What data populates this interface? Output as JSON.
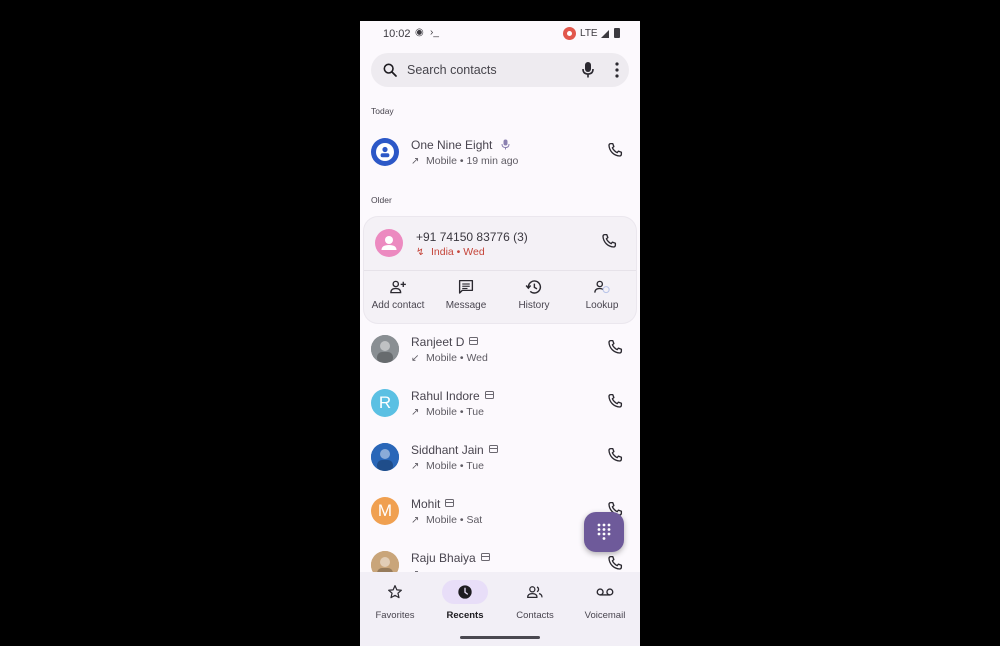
{
  "status_bar": {
    "time": "10:02",
    "network": "LTE"
  },
  "search": {
    "placeholder": "Search contacts",
    "value": ""
  },
  "sections": {
    "today": "Today",
    "older": "Older"
  },
  "calls_today": [
    {
      "name": "One Nine Eight",
      "direction": "outgoing",
      "direction_glyph": "↗",
      "detail": "Mobile • 19 min ago",
      "avatar_color": "#2c58c7",
      "avatar_type": "icon",
      "badge": "mic"
    }
  ],
  "expanded_call": {
    "name": "+91 74150 83776  (3)",
    "direction": "missed",
    "direction_glyph": "↯",
    "detail": "India • Wed",
    "detail_color": "#c5453a",
    "avatar_color": "#ec8ac0",
    "actions": [
      {
        "label": "Add contact",
        "icon": "add-contact"
      },
      {
        "label": "Message",
        "icon": "message"
      },
      {
        "label": "History",
        "icon": "history"
      },
      {
        "label": "Lookup",
        "icon": "lookup"
      }
    ]
  },
  "calls_older": [
    {
      "name": "Ranjeet D",
      "direction": "incoming",
      "direction_glyph": "↙",
      "detail": "Mobile • Wed",
      "avatar_type": "photo",
      "avatar_color": "#8a8f93",
      "avatar_letter": ""
    },
    {
      "name": "Rahul Indore",
      "direction": "outgoing",
      "direction_glyph": "↗",
      "detail": "Mobile • Tue",
      "avatar_type": "letter",
      "avatar_color": "#5bc0e3",
      "avatar_letter": "R"
    },
    {
      "name": "Siddhant Jain",
      "direction": "outgoing",
      "direction_glyph": "↗",
      "detail": "Mobile • Tue",
      "avatar_type": "photo",
      "avatar_color": "#2a67b8",
      "avatar_letter": ""
    },
    {
      "name": "Mohit",
      "direction": "outgoing",
      "direction_glyph": "↗",
      "detail": "Mobile • Sat",
      "avatar_type": "letter",
      "avatar_color": "#f0a050",
      "avatar_letter": "M"
    },
    {
      "name": "Raju Bhaiya",
      "direction": "outgoing",
      "direction_glyph": "↗",
      "detail": "",
      "avatar_type": "photo",
      "avatar_color": "#c9a57a",
      "avatar_letter": ""
    }
  ],
  "fab": {
    "icon": "dialpad",
    "color": "#6e5a9a"
  },
  "bottom_nav": [
    {
      "label": "Favorites",
      "icon": "star",
      "active": false
    },
    {
      "label": "Recents",
      "icon": "clock",
      "active": true
    },
    {
      "label": "Contacts",
      "icon": "people",
      "active": false
    },
    {
      "label": "Voicemail",
      "icon": "voicemail",
      "active": false
    }
  ]
}
